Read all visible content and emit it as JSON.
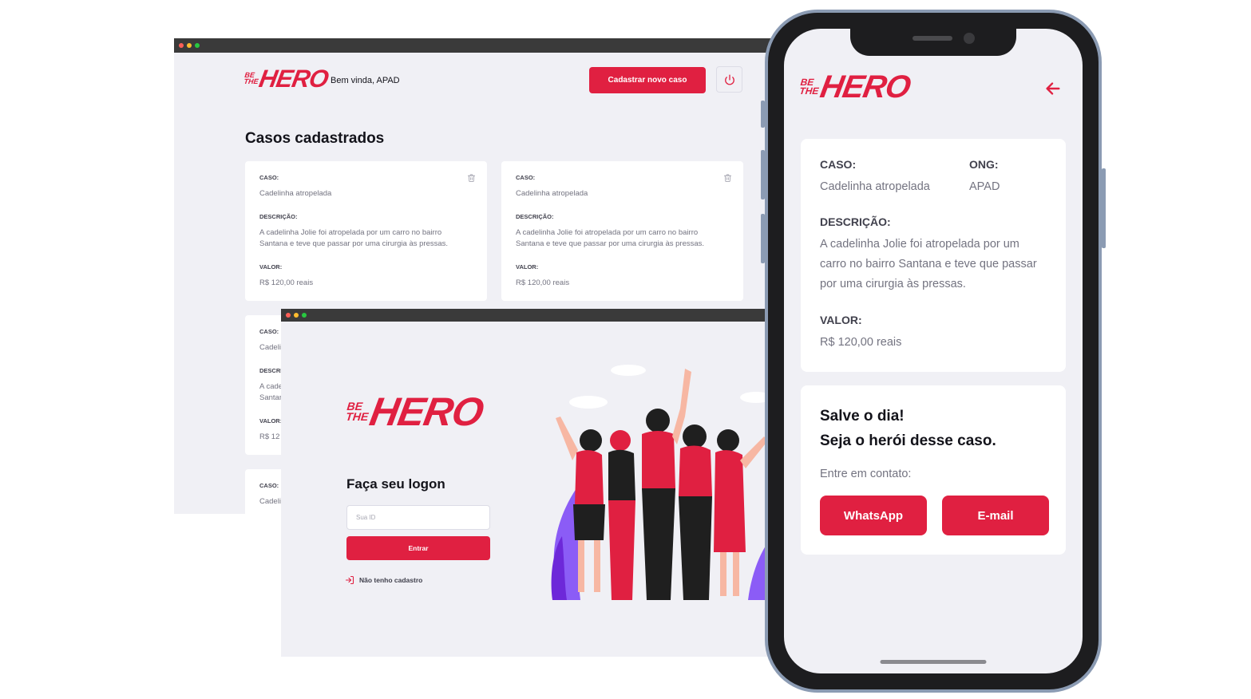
{
  "brand": {
    "be": "BE",
    "the": "THE",
    "hero": "HERO",
    "color": "#e02041"
  },
  "profile": {
    "greeting": "Bem vinda, APAD",
    "new_case_button": "Cadastrar novo caso",
    "title": "Casos cadastrados",
    "cards": [
      {
        "case_label": "CASO:",
        "case_value": "Cadelinha atropelada",
        "desc_label": "DESCRIÇÃO:",
        "desc_value": "A cadelinha Jolie foi atropelada por um carro no bairro Santana e teve que passar por uma cirurgia às pressas.",
        "value_label": "VALOR:",
        "value_value": "R$ 120,00 reais"
      },
      {
        "case_label": "CASO:",
        "case_value": "Cadelinha atropelada",
        "desc_label": "DESCRIÇÃO:",
        "desc_value": "A cadelinha Jolie foi atropelada por um carro no bairro Santana e teve que passar por uma cirurgia às pressas.",
        "value_label": "VALOR:",
        "value_value": "R$ 120,00 reais"
      },
      {
        "case_label": "CASO:",
        "case_value": "Cadeli",
        "desc_label": "DESCRI",
        "desc_value_line1": "A cade",
        "desc_value_line2": "Santar",
        "value_label": "VALOR:",
        "value_value": "R$ 12"
      },
      {
        "case_label": "CASO:",
        "case_value": "Cadeli"
      }
    ]
  },
  "logon": {
    "title": "Faça seu logon",
    "id_placeholder": "Sua ID",
    "submit_button": "Entrar",
    "register_link": "Não tenho cadastro"
  },
  "detail": {
    "case_label": "CASO:",
    "case_value": "Cadelinha atropelada",
    "ong_label": "ONG:",
    "ong_value": "APAD",
    "desc_label": "DESCRIÇÃO:",
    "desc_line1": "A cadelinha Jolie foi atropelada por um",
    "desc_line2": "carro no bairro Santana e teve que passar",
    "desc_line3": "por uma cirurgia às pressas.",
    "value_label": "VALOR:",
    "value_value": "R$ 120,00 reais",
    "heading_line1": "Salve o dia!",
    "heading_line2": "Seja o herói desse caso.",
    "contact_label": "Entre em contato:",
    "whatsapp_button": "WhatsApp",
    "email_button": "E-mail"
  },
  "icons": [
    "trash-icon",
    "power-icon",
    "log-in-icon",
    "arrow-left-icon"
  ]
}
